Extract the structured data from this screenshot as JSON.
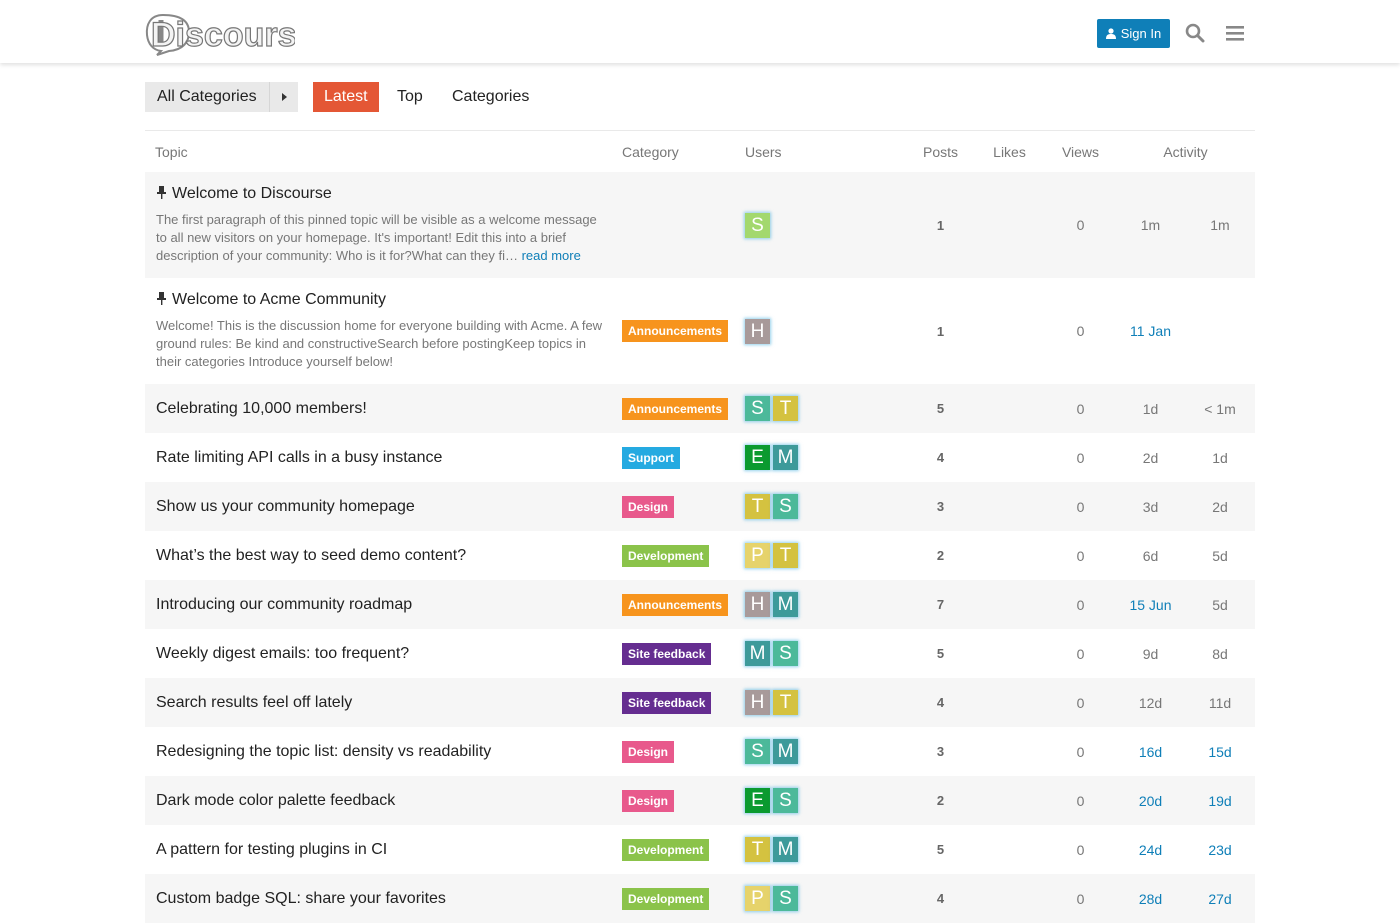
{
  "header": {
    "logo_text": "Discourse",
    "sign_in_label": "Sign In"
  },
  "nav": {
    "category_dropdown": "All Categories",
    "tabs": [
      "Latest",
      "Top",
      "Categories"
    ]
  },
  "columns": [
    "Topic",
    "Category",
    "Users",
    "Posts",
    "Likes",
    "Views",
    "Activity"
  ],
  "topics": [
    {
      "title": "Welcome to Discourse",
      "pinned": true,
      "excerpt": "The first paragraph of this pinned topic will be visible as a welcome message to all new visitors on your homepage. It's important! Edit this into a brief description of your community: Who is it for?What can they fi…",
      "read_more": "read more",
      "category": "",
      "category_color": "",
      "users": [
        {
          "letter": "S",
          "color": "#a3d86e"
        }
      ],
      "posts": "1",
      "likes": "",
      "views": "0",
      "created": "1m",
      "last": "1m",
      "created_hl": false,
      "last_hl": false
    },
    {
      "title": "Welcome to Acme Community",
      "pinned": true,
      "excerpt": "Welcome! This is the discussion home for everyone building with Acme. A few ground rules: Be kind and constructiveSearch before postingKeep topics in their categories Introduce yourself below!",
      "read_more": "",
      "category": "Announcements",
      "category_color": "#f7941d",
      "users": [
        {
          "letter": "H",
          "color": "#a89a9a"
        }
      ],
      "posts": "1",
      "likes": "",
      "views": "0",
      "created": "11 Jan",
      "last": "",
      "created_hl": true,
      "last_hl": false
    },
    {
      "title": "Celebrating 10,000 members!",
      "pinned": false,
      "category": "Announcements",
      "category_color": "#f7941d",
      "users": [
        {
          "letter": "S",
          "color": "#4cb99a"
        },
        {
          "letter": "T",
          "color": "#d4c240"
        }
      ],
      "posts": "5",
      "likes": "",
      "views": "0",
      "created": "1d",
      "last": "< 1m",
      "created_hl": false,
      "last_hl": false
    },
    {
      "title": "Rate limiting API calls in a busy instance",
      "pinned": false,
      "category": "Support",
      "category_color": "#25aae1",
      "users": [
        {
          "letter": "E",
          "color": "#0b9a2f"
        },
        {
          "letter": "M",
          "color": "#3d9a9a"
        }
      ],
      "posts": "4",
      "likes": "",
      "views": "0",
      "created": "2d",
      "last": "1d",
      "created_hl": false,
      "last_hl": false
    },
    {
      "title": "Show us your community homepage",
      "pinned": false,
      "category": "Design",
      "category_color": "#e8598c",
      "users": [
        {
          "letter": "T",
          "color": "#d4c240"
        },
        {
          "letter": "S",
          "color": "#4cb99a"
        }
      ],
      "posts": "3",
      "likes": "",
      "views": "0",
      "created": "3d",
      "last": "2d",
      "created_hl": false,
      "last_hl": false
    },
    {
      "title": "What’s the best way to seed demo content?",
      "pinned": false,
      "category": "Development",
      "category_color": "#8bc34a",
      "users": [
        {
          "letter": "P",
          "color": "#e6d36b"
        },
        {
          "letter": "T",
          "color": "#d4c240"
        }
      ],
      "posts": "2",
      "likes": "",
      "views": "0",
      "created": "6d",
      "last": "5d",
      "created_hl": false,
      "last_hl": false
    },
    {
      "title": "Introducing our community roadmap",
      "pinned": false,
      "category": "Announcements",
      "category_color": "#f7941d",
      "users": [
        {
          "letter": "H",
          "color": "#a89a9a"
        },
        {
          "letter": "M",
          "color": "#3d9a9a"
        }
      ],
      "posts": "7",
      "likes": "",
      "views": "0",
      "created": "15 Jun",
      "last": "5d",
      "created_hl": true,
      "last_hl": false
    },
    {
      "title": "Weekly digest emails: too frequent?",
      "pinned": false,
      "category": "Site feedback",
      "category_color": "#652d90",
      "users": [
        {
          "letter": "M",
          "color": "#3d9a9a"
        },
        {
          "letter": "S",
          "color": "#4cb99a"
        }
      ],
      "posts": "5",
      "likes": "",
      "views": "0",
      "created": "9d",
      "last": "8d",
      "created_hl": false,
      "last_hl": false
    },
    {
      "title": "Search results feel off lately",
      "pinned": false,
      "category": "Site feedback",
      "category_color": "#652d90",
      "users": [
        {
          "letter": "H",
          "color": "#a89a9a"
        },
        {
          "letter": "T",
          "color": "#d4c240"
        }
      ],
      "posts": "4",
      "likes": "",
      "views": "0",
      "created": "12d",
      "last": "11d",
      "created_hl": false,
      "last_hl": false
    },
    {
      "title": "Redesigning the topic list: density vs readability",
      "pinned": false,
      "category": "Design",
      "category_color": "#e8598c",
      "users": [
        {
          "letter": "S",
          "color": "#4cb99a"
        },
        {
          "letter": "M",
          "color": "#3d9a9a"
        }
      ],
      "posts": "3",
      "likes": "",
      "views": "0",
      "created": "16d",
      "last": "15d",
      "created_hl": true,
      "last_hl": true
    },
    {
      "title": "Dark mode color palette feedback",
      "pinned": false,
      "category": "Design",
      "category_color": "#e8598c",
      "users": [
        {
          "letter": "E",
          "color": "#0b9a2f"
        },
        {
          "letter": "S",
          "color": "#4cb99a"
        }
      ],
      "posts": "2",
      "likes": "",
      "views": "0",
      "created": "20d",
      "last": "19d",
      "created_hl": true,
      "last_hl": true
    },
    {
      "title": "A pattern for testing plugins in CI",
      "pinned": false,
      "category": "Development",
      "category_color": "#8bc34a",
      "users": [
        {
          "letter": "T",
          "color": "#d4c240"
        },
        {
          "letter": "M",
          "color": "#3d9a9a"
        }
      ],
      "posts": "5",
      "likes": "",
      "views": "0",
      "created": "24d",
      "last": "23d",
      "created_hl": true,
      "last_hl": true
    },
    {
      "title": "Custom badge SQL: share your favorites",
      "pinned": false,
      "category": "Development",
      "category_color": "#8bc34a",
      "users": [
        {
          "letter": "P",
          "color": "#e6d36b"
        },
        {
          "letter": "S",
          "color": "#4cb99a"
        }
      ],
      "posts": "4",
      "likes": "",
      "views": "0",
      "created": "28d",
      "last": "27d",
      "created_hl": true,
      "last_hl": true
    }
  ]
}
